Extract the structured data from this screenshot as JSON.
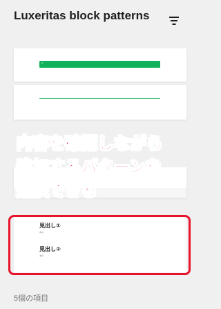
{
  "panel": {
    "title": "Luxeritas block patterns",
    "filter_icon": "filter-lines-icon"
  },
  "previews": {
    "card1_button_text": "↙"
  },
  "annotation": {
    "lines": [
      "内容を確認しながら",
      "追加するパターンを",
      "選択できる"
    ]
  },
  "headings": [
    {
      "title": "見出し①",
      "sub": "本文"
    },
    {
      "title": "見出し②",
      "sub": "本文"
    }
  ],
  "footer": {
    "count_label": "5個の項目"
  },
  "colors": {
    "accent_green": "#11b25b",
    "annotation_red": "#e8122b"
  }
}
